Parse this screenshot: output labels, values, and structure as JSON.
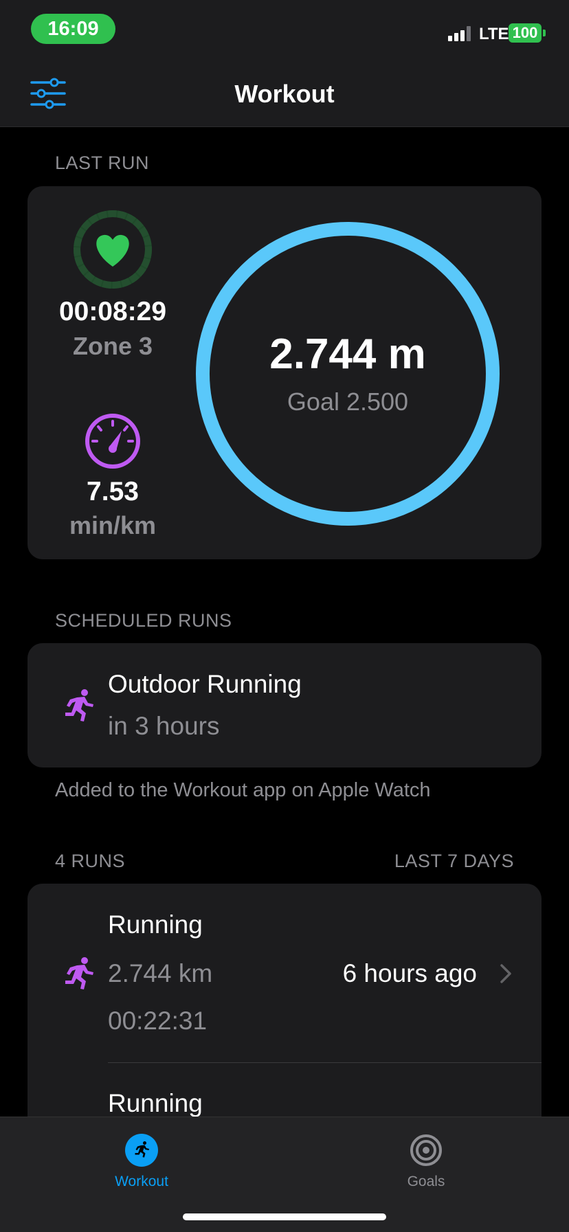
{
  "status_bar": {
    "time": "16:09",
    "network": "LTE",
    "battery": "100"
  },
  "nav": {
    "title": "Workout",
    "filter_icon": "sliders-icon"
  },
  "last_run": {
    "header": "LAST RUN",
    "heart_rate_time": "00:08:29",
    "zone": "Zone 3",
    "pace_value": "7.53",
    "pace_unit": "min/km",
    "distance": "2.744 m",
    "goal": "Goal 2.500"
  },
  "scheduled": {
    "header": "SCHEDULED RUNS",
    "title": "Outdoor Running",
    "subtitle": "in 3 hours",
    "footnote": "Added to the Workout app on Apple Watch"
  },
  "runs": {
    "header_left": "4 RUNS",
    "header_right": "LAST 7 DAYS",
    "items": [
      {
        "title": "Running",
        "distance": "2.744 km",
        "duration": "00:22:31",
        "ago": "6 hours ago"
      },
      {
        "title": "Running"
      }
    ]
  },
  "tabs": [
    {
      "label": "Workout",
      "icon": "running-icon",
      "active": true
    },
    {
      "label": "Goals",
      "icon": "target-icon",
      "active": false
    }
  ],
  "colors": {
    "accent_blue": "#5ac8fa",
    "tab_active": "#0a9ff5",
    "heart_green": "#34c759",
    "purple": "#bf5af2",
    "time_pill": "#30c04f"
  }
}
